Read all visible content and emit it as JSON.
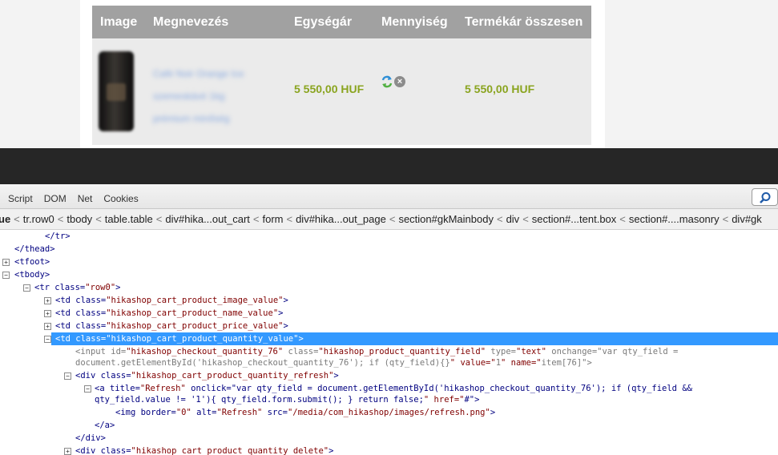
{
  "cart": {
    "headers": {
      "image": "Image",
      "name": "Megnevezés",
      "unit_price": "Egységár",
      "quantity": "Mennyiség",
      "total": "Termékár összesen"
    },
    "row": {
      "name_line1": "Café Noir Orange Ice",
      "name_line2": "szemeskávé 1kg",
      "name_line3": "prémium minőség",
      "unit_price": "5 550,00 HUF",
      "total": "5 550,00 HUF"
    }
  },
  "devtools": {
    "tabs": [
      "Script",
      "DOM",
      "Net",
      "Cookies"
    ],
    "breadcrumbs": [
      "ue",
      "tr.row0",
      "tbody",
      "table.table",
      "div#hika...out_cart",
      "form",
      "div#hika...out_page",
      "section#gkMainbody",
      "div",
      "section#...tent.box",
      "section#....masonry",
      "div#gk"
    ],
    "lines": [
      "</tr>",
      "</thead>",
      "<tfoot>",
      "<tbody>",
      "<tr class=\"row0\">",
      "<td class=\"hikashop_cart_product_image_value\">",
      "<td class=\"hikashop_cart_product_name_value\">",
      "<td class=\"hikashop_cart_product_price_value\">",
      "<td class=\"hikashop_cart_product_quantity_value\">",
      "<input id=\"hikashop_checkout_quantity_76\" class=\"hikashop_product_quantity_field\" type=\"text\" onchange=\"var qty_field =",
      "document.getElementById('hikashop_checkout_quantity_76'); if (qty_field){}\" value=\"1\" name=\"item[76]\">",
      "<div class=\"hikashop_cart_product_quantity_refresh\">",
      "<a title=\"Refresh\" onclick=\"var qty_field = document.getElementById('hikashop_checkout_quantity_76'); if (qty_field &&",
      "qty_field.value != '1'){ qty_field.form.submit(); } return false;\" href=\"#\">",
      "<img border=\"0\" alt=\"Refresh\" src=\"/media/com_hikashop/images/refresh.png\">",
      "</a>",
      "</div>",
      "<div class=\"hikashop_cart_product_quantity_delete\">"
    ]
  },
  "colors": {
    "price": "#8aa41f",
    "header_bg": "#a1a1a1",
    "highlight": "#3399ff"
  }
}
